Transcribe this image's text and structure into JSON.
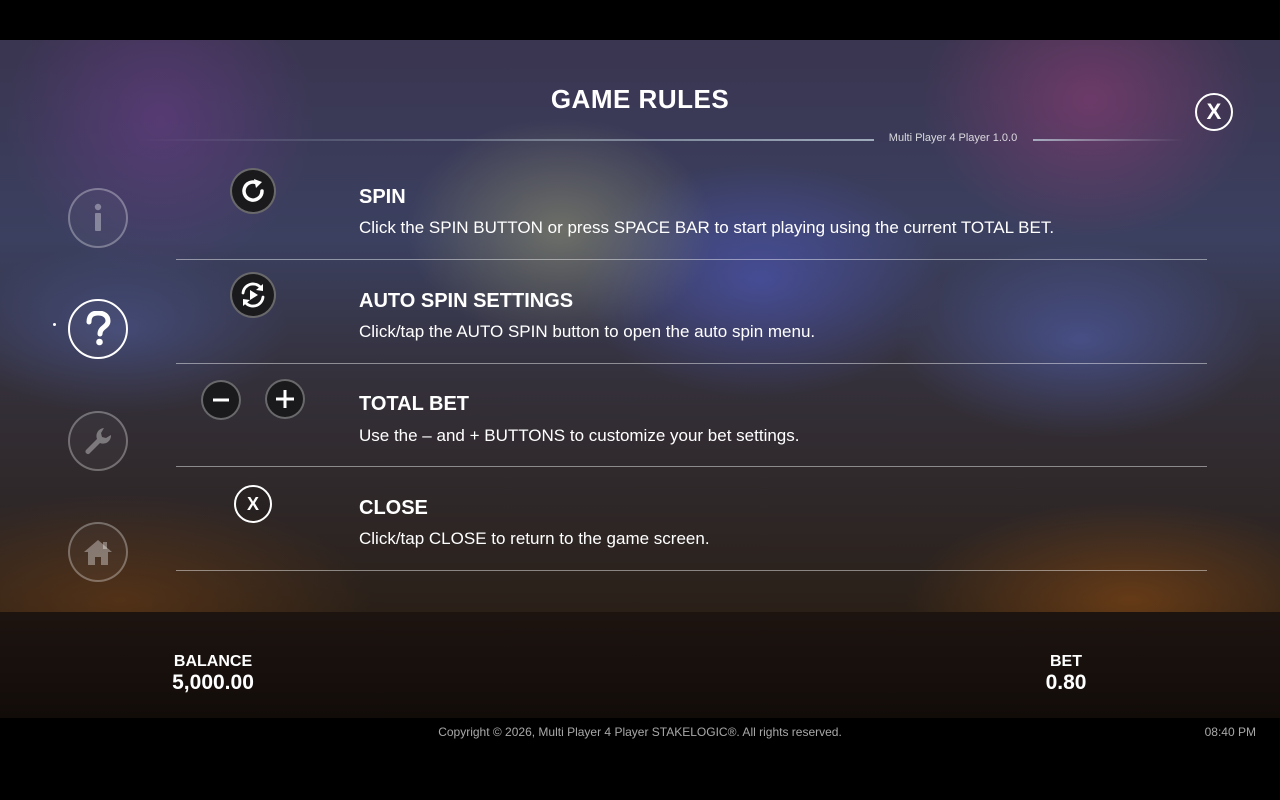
{
  "header": {
    "title": "GAME RULES",
    "version": "Multi Player 4 Player 1.0.0",
    "close_icon": "close-x-icon"
  },
  "sidebar": {
    "items": [
      {
        "name": "info",
        "icon": "info-icon",
        "active": false
      },
      {
        "name": "help",
        "icon": "question-icon",
        "active": true
      },
      {
        "name": "settings",
        "icon": "wrench-icon",
        "active": false
      },
      {
        "name": "home",
        "icon": "home-icon",
        "active": false
      }
    ]
  },
  "rules": [
    {
      "heading": "SPIN",
      "description": "Click the SPIN BUTTON or press SPACE BAR to start playing using the current TOTAL BET.",
      "icon": "spin-icon"
    },
    {
      "heading": "AUTO SPIN SETTINGS",
      "description": "Click/tap the AUTO SPIN button to open the auto spin menu.",
      "icon": "auto-spin-icon"
    },
    {
      "heading": "TOTAL BET",
      "description": "Use the – and + BUTTONS to customize your bet settings.",
      "icon": "minus-plus-icons"
    },
    {
      "heading": "CLOSE",
      "description": "Click/tap CLOSE to return to the game screen.",
      "icon": "close-x-icon"
    }
  ],
  "footer_bar": {
    "balance_label": "BALANCE",
    "balance_value": "5,000.00",
    "bet_label": "BET",
    "bet_value": "0.80"
  },
  "footer": {
    "copyright": "Copyright © 2026, Multi Player 4 Player STAKELOGIC®. All rights reserved.",
    "time": "08:40 PM"
  }
}
